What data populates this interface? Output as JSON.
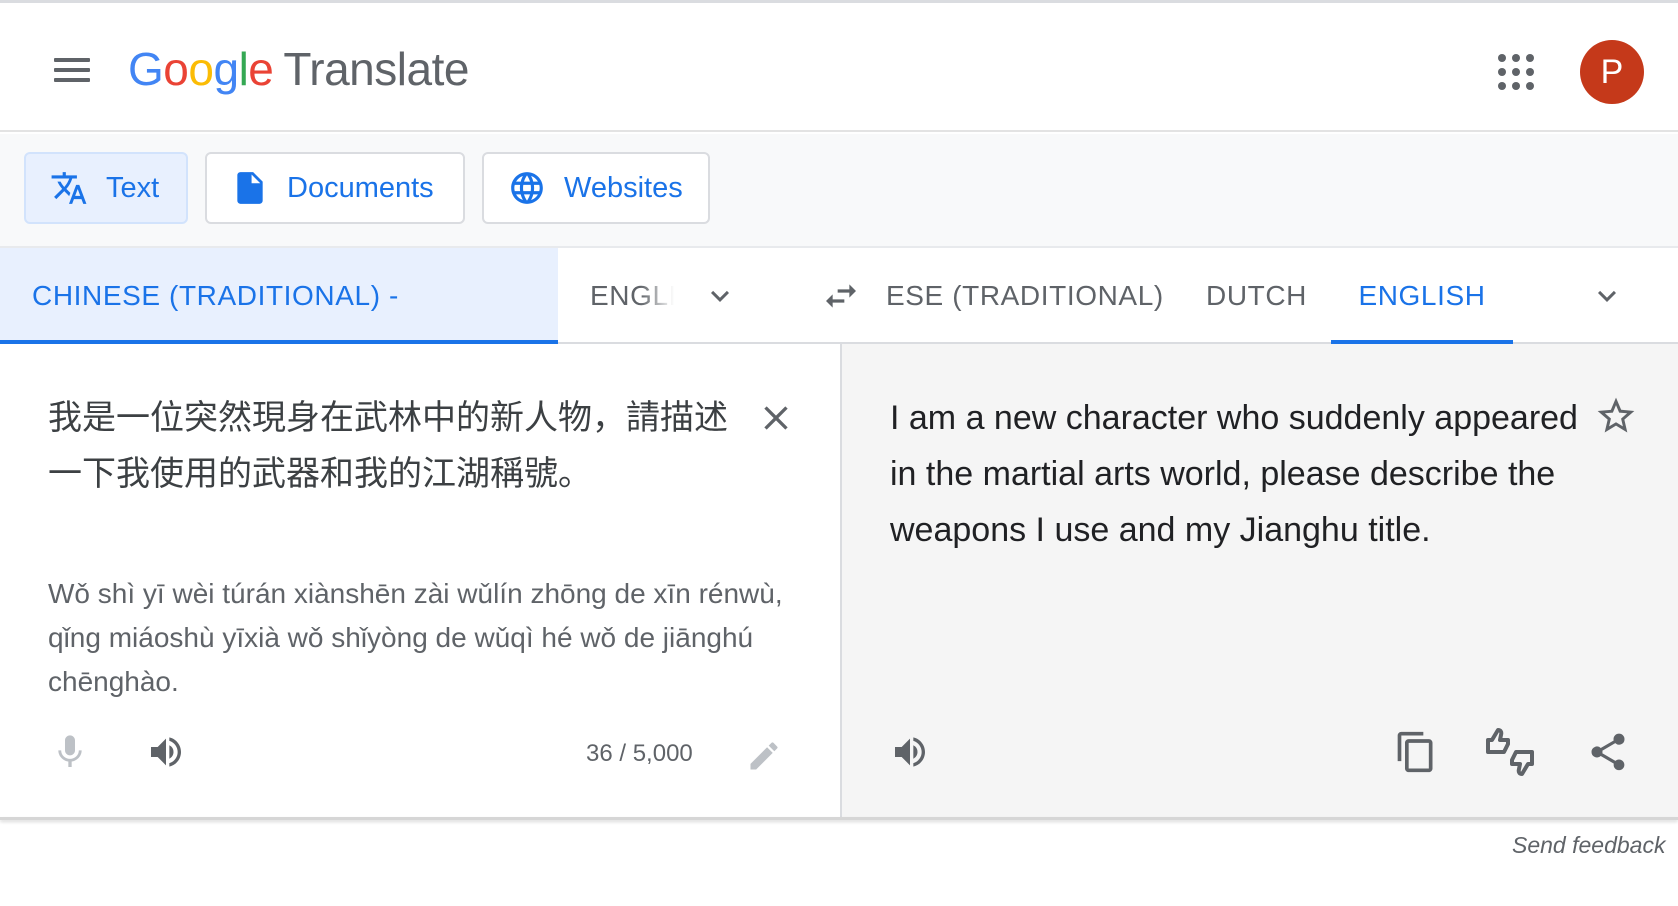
{
  "header": {
    "logo_letters": [
      "G",
      "o",
      "o",
      "g",
      "l",
      "e"
    ],
    "product_name": "Translate",
    "avatar_initial": "P",
    "avatar_color": "#c5391a"
  },
  "modes": [
    {
      "label": "Text",
      "icon": "translate-icon",
      "active": true
    },
    {
      "label": "Documents",
      "icon": "document-icon",
      "active": false
    },
    {
      "label": "Websites",
      "icon": "globe-icon",
      "active": false
    }
  ],
  "source_languages": {
    "detected": "CHINESE (TRADITIONAL) - DETECTED",
    "other": "ENGLI"
  },
  "target_languages": {
    "first": "ESE (TRADITIONAL)",
    "second": "DUTCH",
    "active": "ENGLISH"
  },
  "source": {
    "text": "我是一位突然現身在武林中的新人物，請描述一下我使用的武器和我的江湖稱號。",
    "transliteration": "Wǒ shì yī wèi túrán xiànshēn zài wǔlín zhōng de xīn rénwù, qǐng miáoshù yīxià wǒ shǐyòng de wǔqì hé wǒ de jiānghú chēnghào.",
    "char_count": "36 / 5,000"
  },
  "target": {
    "text": "I am a new character who suddenly appeared in the martial arts world, please describe the weapons I use and my Jianghu title."
  },
  "footer": {
    "feedback": "Send feedback"
  },
  "colors": {
    "accent": "#1a73e8",
    "icon_gray": "#5f6368"
  }
}
